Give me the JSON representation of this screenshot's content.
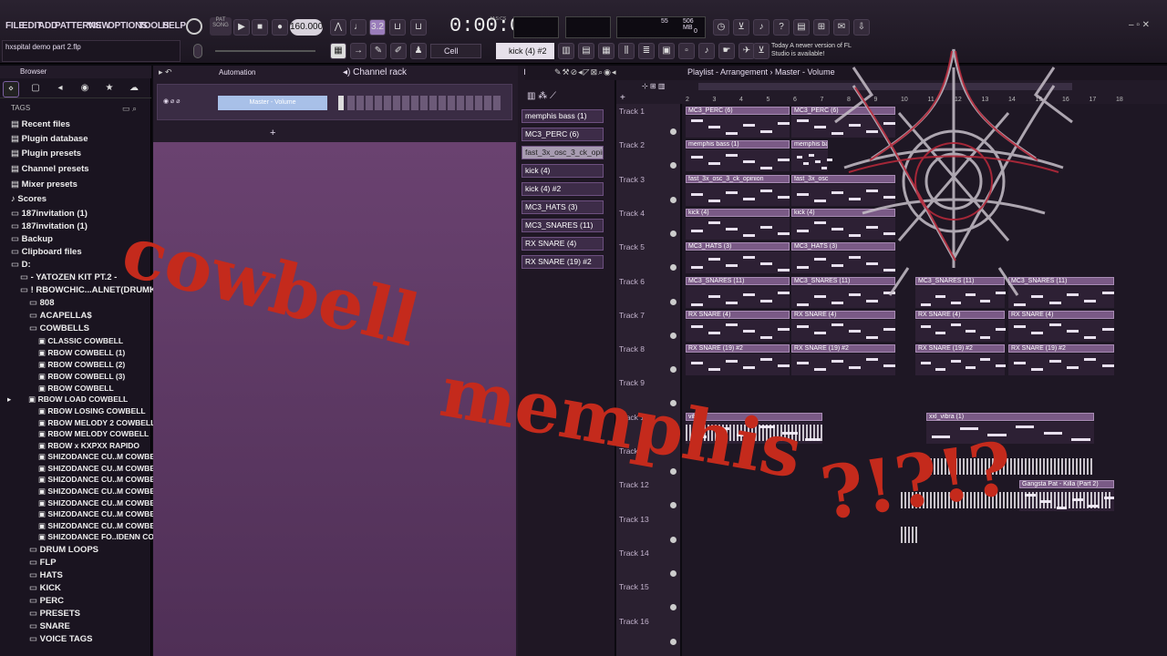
{
  "menu": [
    "FILE",
    "EDIT",
    "ADD",
    "PATTERNS",
    "VIEW",
    "OPTIONS",
    "TOOLS",
    "HELP"
  ],
  "transport": {
    "pat": "PAT",
    "song": "SONG",
    "tempo": "160.000",
    "time": "0:00:00",
    "time_label": "M:S:CS",
    "snap": "3.2",
    "cpu": "55",
    "mem": "506 MB",
    "voices": "0"
  },
  "project_file": "hxspital demo part 2.flp",
  "toolbar": {
    "mode": "Cell",
    "channel": "kick (4) #2",
    "news": "Today A newer version of FL Studio is available!"
  },
  "browser": {
    "title": "Browser",
    "tags": "TAGS",
    "items": [
      "Recent files",
      "Plugin database",
      "Plugin presets",
      "Channel presets",
      "Mixer presets",
      "Scores",
      "187invitation (1)",
      "187invitation (1)",
      "Backup",
      "Clipboard files",
      "D:",
      "- YATOZEN KIT PT.2 -",
      "! RBOWCHIC...ALNET(DRUMKIT)",
      "808",
      "ACAPELLA$",
      "COWBELLS",
      "CLASSIC COWBELL",
      "RBOW COWBELL (1)",
      "RBOW COWBELL (2)",
      "RBOW COWBELL (3)",
      "RBOW COWBELL",
      "RBOW LOAD COWBELL",
      "RBOW LOSING COWBELL",
      "RBOW MELODY 2 COWBELL",
      "RBOW MELODY COWBELL",
      "RBOW x KXPXX RAPIDO",
      "SHIZODANCE CU..M COWBELL (1)",
      "SHIZODANCE CU..M COWBELL (2)",
      "SHIZODANCE CU..M COWBELL (3)",
      "SHIZODANCE CU..M COWBELL (4)",
      "SHIZODANCE CU..M COWBELL (5)",
      "SHIZODANCE CU..M COWBELL (6)",
      "SHIZODANCE CU..M COWBELL (7)",
      "SHIZODANCE FO..IDENN COWBELL",
      "DRUM LOOPS",
      "FLP",
      "HATS",
      "KICK",
      "PERC",
      "PRESETS",
      "SNARE",
      "VOICE TAGS"
    ]
  },
  "automation": {
    "label": "Automation",
    "clip": "Master - Volume"
  },
  "channel_rack": {
    "title": "Channel rack",
    "channels": [
      "memphis bass (1)",
      "MC3_PERC (6)",
      "fast_3x_osc_3_ck_opinion",
      "kick (4)",
      "kick (4) #2",
      "MC3_HATS (3)",
      "MC3_SNARES (11)",
      "RX SNARE (4)",
      "RX SNARE (19) #2"
    ]
  },
  "playlist": {
    "title": "Playlist - Arrangement",
    "breadcrumb": "Master - Volume",
    "tracks": [
      "Track 1",
      "Track 2",
      "Track 3",
      "Track 4",
      "Track 5",
      "Track 6",
      "Track 7",
      "Track 8",
      "Track 9",
      "Track 10",
      "Track 11",
      "Track 12",
      "Track 13",
      "Track 14",
      "Track 15",
      "Track 16"
    ],
    "bars": [
      "2",
      "3",
      "4",
      "5",
      "6",
      "7",
      "8",
      "9",
      "10",
      "11",
      "12",
      "13",
      "14",
      "15",
      "16",
      "17",
      "18"
    ],
    "clips": [
      "MC3_PERC (6)",
      "MC3_PERC (6)",
      "memphis bass (1)",
      "memphis bass (1)",
      "fast_3x_osc_3_ck_opinion",
      "fast_3x_osc",
      "kick (4)",
      "kick (4)",
      "MC3_HATS (3)",
      "MC3_HATS (3)",
      "MC3_SNARES (11)",
      "MC3_SNARES (11)",
      "MC3_SNARES (11)",
      "MC3_SNARES (11)",
      "RX SNARE (4)",
      "RX SNARE (4)",
      "RX SNARE (4)",
      "RX SNARE (4)",
      "RX SNARE (19) #2",
      "RX SNARE (19) #2",
      "RX SNARE (19) #2",
      "RX SNARE (19) #2",
      "vibra",
      "xxl_vibra (1)",
      "Gangsta Pat - Killa (Part 2)"
    ]
  },
  "overlay": {
    "line1": "cowbell",
    "line2": "memphis",
    "line3": "?!?!?"
  },
  "colors": {
    "accent": "#c42a1c",
    "pane": "#5f3a66",
    "clip": "#7a5a86"
  }
}
